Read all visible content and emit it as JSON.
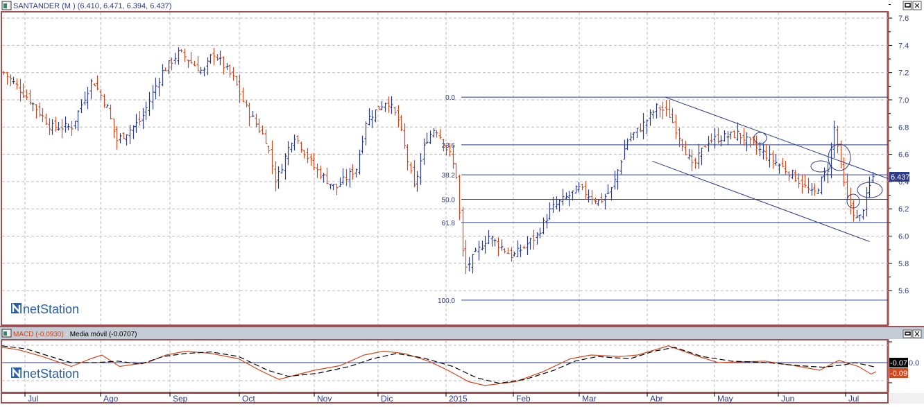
{
  "window": {
    "title": "SANTANDER (M ) (6.410, 6.471, 6.394, 6.437)",
    "logo_text": "netStation"
  },
  "macd_panel": {
    "macd_label": "MACD (-0.0930)",
    "separator": " - ",
    "signal_label": "Media móvil (-0.0707)",
    "zero_label": "0.0",
    "signal_value_badge": "-0.07",
    "macd_value_badge": "-0.09"
  },
  "colors": {
    "up": "#2b3a8a",
    "down": "#d2461c",
    "frame": "#a05050",
    "macd": "#d2461c",
    "signal": "#000000",
    "lines": "#2b3a8a"
  },
  "chart_data": [
    {
      "type": "ohlc",
      "title": "SANTANDER (M )",
      "last": {
        "open": 6.41,
        "high": 6.471,
        "low": 6.394,
        "close": 6.437
      },
      "last_price_label": "6.437",
      "x_tick_labels": [
        "Jul",
        "Ago",
        "Sep",
        "Oct",
        "Nov",
        "Dic",
        "2015",
        "Feb",
        "Mar",
        "Abr",
        "May",
        "Jun",
        "Jul"
      ],
      "y_tick_labels": [
        "7.6",
        "7.4",
        "7.2",
        "7.0",
        "6.8",
        "6.6",
        "6.4",
        "6.2",
        "6.0",
        "5.8",
        "5.6"
      ],
      "ylim": [
        5.4,
        7.65
      ],
      "grid": true,
      "price_path_week_close": [
        [
          0.1,
          7.2
        ],
        [
          1.7,
          7.0
        ],
        [
          3.0,
          6.8
        ],
        [
          4.3,
          6.8
        ],
        [
          5.6,
          7.15
        ],
        [
          6.5,
          6.95
        ],
        [
          7.1,
          6.7
        ],
        [
          8.6,
          6.85
        ],
        [
          9.9,
          7.2
        ],
        [
          11.0,
          7.35
        ],
        [
          12.5,
          7.2
        ],
        [
          13.1,
          7.35
        ],
        [
          14.4,
          7.15
        ],
        [
          15.1,
          6.95
        ],
        [
          16.4,
          6.7
        ],
        [
          17.0,
          6.4
        ],
        [
          18.1,
          6.75
        ],
        [
          19.4,
          6.5
        ],
        [
          20.7,
          6.35
        ],
        [
          22.0,
          6.5
        ],
        [
          22.6,
          6.85
        ],
        [
          23.9,
          7.0
        ],
        [
          24.6,
          6.85
        ],
        [
          25.6,
          6.35
        ],
        [
          26.3,
          6.7
        ],
        [
          26.9,
          6.8
        ],
        [
          27.8,
          6.6
        ],
        [
          28.2,
          6.45
        ],
        [
          28.7,
          5.75
        ],
        [
          30.2,
          6.0
        ],
        [
          31.7,
          5.85
        ],
        [
          33.2,
          6.0
        ],
        [
          34.1,
          6.2
        ],
        [
          35.8,
          6.35
        ],
        [
          37.1,
          6.25
        ],
        [
          37.9,
          6.35
        ],
        [
          38.8,
          6.7
        ],
        [
          39.7,
          6.8
        ],
        [
          40.7,
          6.95
        ],
        [
          41.4,
          6.9
        ],
        [
          42.2,
          6.7
        ],
        [
          42.9,
          6.5
        ],
        [
          43.8,
          6.7
        ],
        [
          45.7,
          6.75
        ],
        [
          47.4,
          6.6
        ],
        [
          49.1,
          6.45
        ],
        [
          50.4,
          6.3
        ],
        [
          51.3,
          6.5
        ],
        [
          51.7,
          6.8
        ],
        [
          52.4,
          6.3
        ],
        [
          53.2,
          6.1
        ],
        [
          54.1,
          6.437
        ]
      ],
      "fibonacci": {
        "levels": [
          {
            "label": "0.0",
            "price": 7.02
          },
          {
            "label": "23.6",
            "price": 6.67
          },
          {
            "label": "38.2",
            "price": 6.45
          },
          {
            "label": "50.0",
            "price": 6.27
          },
          {
            "label": "61.8",
            "price": 6.1
          },
          {
            "label": "100.0",
            "price": 5.53
          }
        ]
      },
      "trend_channel": {
        "upper": [
          [
            41.2,
            7.02
          ],
          [
            55.1,
            6.42
          ]
        ],
        "lower": [
          [
            40.4,
            6.55
          ],
          [
            53.9,
            5.96
          ]
        ]
      }
    },
    {
      "type": "line",
      "title": "MACD",
      "ylim": [
        -0.35,
        0.35
      ],
      "series": [
        {
          "name": "MACD (-0.0930)",
          "points": [
            [
              0,
              0.2
            ],
            [
              1,
              0.17
            ],
            [
              2.5,
              0.08
            ],
            [
              4.3,
              -0.05
            ],
            [
              5.5,
              0.05
            ],
            [
              6.2,
              0.1
            ],
            [
              7.3,
              -0.05
            ],
            [
              9.0,
              0.0
            ],
            [
              10.2,
              0.1
            ],
            [
              11.4,
              0.15
            ],
            [
              13,
              0.12
            ],
            [
              14.7,
              0.05
            ],
            [
              16,
              -0.1
            ],
            [
              17.2,
              -0.22
            ],
            [
              19.4,
              -0.1
            ],
            [
              21,
              -0.04
            ],
            [
              22.5,
              0.1
            ],
            [
              23.7,
              0.15
            ],
            [
              25,
              0.12
            ],
            [
              26.5,
              0.02
            ],
            [
              27.7,
              -0.1
            ],
            [
              29,
              -0.25
            ],
            [
              30,
              -0.3
            ],
            [
              31.9,
              -0.25
            ],
            [
              33.6,
              -0.12
            ],
            [
              35.3,
              0.05
            ],
            [
              36.6,
              0.1
            ],
            [
              38.4,
              0.08
            ],
            [
              39.5,
              0.1
            ],
            [
              41.4,
              0.22
            ],
            [
              43,
              0.1
            ],
            [
              44.5,
              0.0
            ],
            [
              47.4,
              0.02
            ],
            [
              49.5,
              -0.05
            ],
            [
              50.8,
              -0.1
            ],
            [
              52,
              0.03
            ],
            [
              53.2,
              -0.05
            ],
            [
              54,
              -0.15
            ],
            [
              54.3,
              -0.12
            ]
          ]
        },
        {
          "name": "Media móvil (-0.0707)",
          "points": [
            [
              0,
              0.22
            ],
            [
              1.5,
              0.18
            ],
            [
              3,
              0.08
            ],
            [
              4.3,
              0.0
            ],
            [
              5.8,
              0.0
            ],
            [
              7.2,
              0.02
            ],
            [
              8.6,
              -0.02
            ],
            [
              10,
              0.08
            ],
            [
              11.4,
              0.12
            ],
            [
              13,
              0.14
            ],
            [
              14.7,
              0.08
            ],
            [
              16.5,
              -0.1
            ],
            [
              17.8,
              -0.18
            ],
            [
              19.6,
              -0.14
            ],
            [
              21.6,
              -0.05
            ],
            [
              23,
              0.05
            ],
            [
              24.5,
              0.12
            ],
            [
              26.2,
              0.06
            ],
            [
              28,
              -0.05
            ],
            [
              29.5,
              -0.2
            ],
            [
              30.9,
              -0.27
            ],
            [
              32.5,
              -0.22
            ],
            [
              34.3,
              -0.1
            ],
            [
              35.6,
              0.02
            ],
            [
              37,
              0.08
            ],
            [
              39,
              0.05
            ],
            [
              40.5,
              0.15
            ],
            [
              41.8,
              0.2
            ],
            [
              43.5,
              0.08
            ],
            [
              45.3,
              0.02
            ],
            [
              47.6,
              0.0
            ],
            [
              49.5,
              -0.04
            ],
            [
              51,
              -0.06
            ],
            [
              52.3,
              -0.03
            ],
            [
              53,
              0.0
            ],
            [
              54.3,
              -0.06
            ]
          ]
        }
      ]
    }
  ]
}
